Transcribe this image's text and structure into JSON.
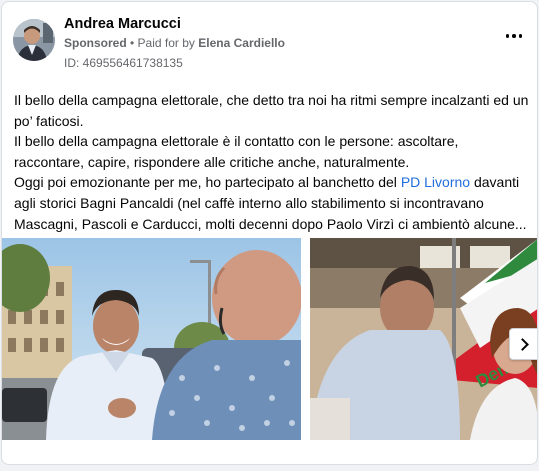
{
  "post": {
    "page_name": "Andrea Marcucci",
    "sponsored_label": "Sponsored",
    "separator": " • ",
    "paid_prefix": "Paid for by ",
    "paid_by": "Elena Cardiello",
    "ad_id": "ID: 469556461738135",
    "more_icon": "more-horizontal-icon",
    "text": {
      "line1": "Il bello della campagna elettorale, che detto tra noi ha ritmi sempre incalzanti ed un po’ faticosi.",
      "line2": "Il bello della campagna elettorale è il contatto con le persone: ascoltare, raccontare, capire, rispondere alle critiche anche, naturalmente.",
      "line3_a": "Oggi poi emozionante per me, ho partecipato al banchetto del ",
      "line3_tag": "PD Livorno",
      "line3_b": " davanti agli storici Bagni Pancaldi (nel caffè interno allo stabilimento si incontravano",
      "line4": "Mascagni, Pascoli e Carducci, molti decenni dopo Paolo Virzì ci ambientò alcune..."
    },
    "colors": {
      "link": "#216fdb",
      "meta": "#65676b"
    },
    "carousel": {
      "next_icon": "chevron-right-icon"
    }
  }
}
